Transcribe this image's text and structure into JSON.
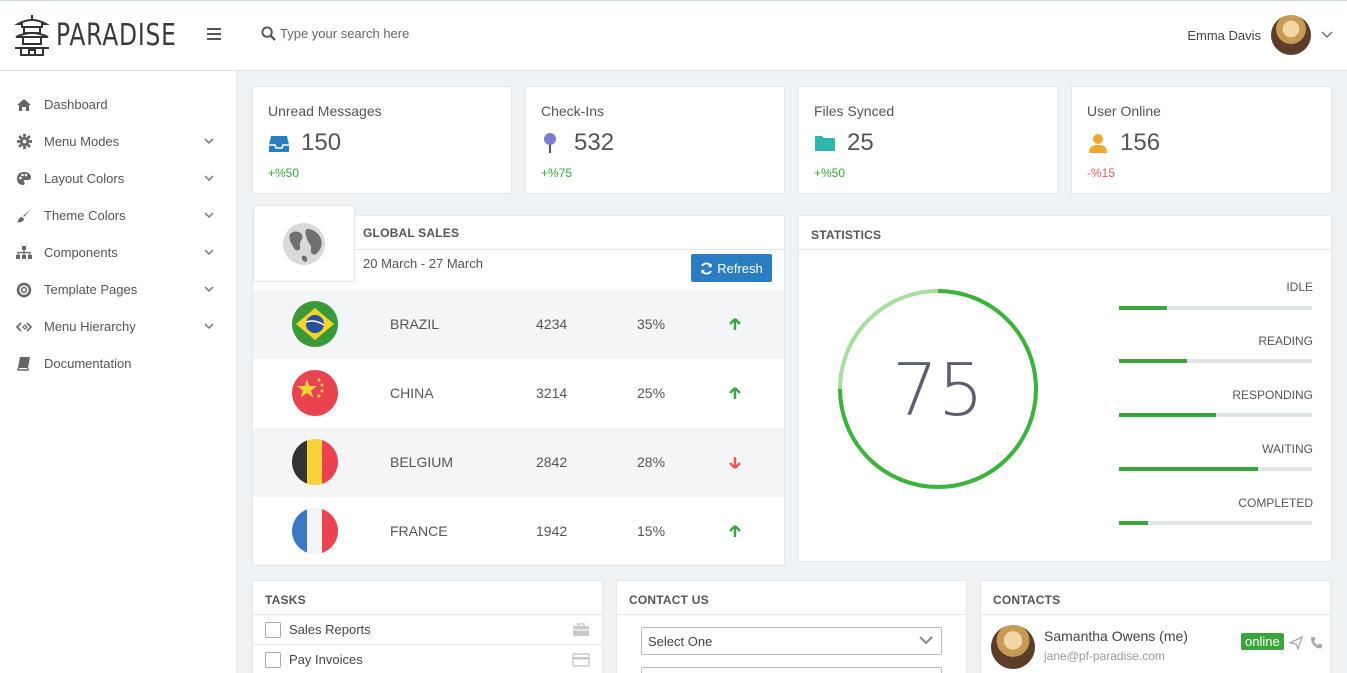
{
  "app": {
    "logo_text": "PARADISE"
  },
  "search": {
    "placeholder": "Type your search here"
  },
  "user": {
    "name": "Emma Davis"
  },
  "sidebar": {
    "items": [
      {
        "label": "Dashboard",
        "icon": "home-icon",
        "has_submenu": false
      },
      {
        "label": "Menu Modes",
        "icon": "gear-icon",
        "has_submenu": true
      },
      {
        "label": "Layout Colors",
        "icon": "palette-icon",
        "has_submenu": true
      },
      {
        "label": "Theme Colors",
        "icon": "brush-icon",
        "has_submenu": true
      },
      {
        "label": "Components",
        "icon": "sitemap-icon",
        "has_submenu": true
      },
      {
        "label": "Template Pages",
        "icon": "life-ring-icon",
        "has_submenu": true
      },
      {
        "label": "Menu Hierarchy",
        "icon": "code-icon",
        "has_submenu": true
      },
      {
        "label": "Documentation",
        "icon": "book-icon",
        "has_submenu": false
      }
    ]
  },
  "stats": [
    {
      "title": "Unread Messages",
      "value": "150",
      "change": "+%50",
      "trend": "positive",
      "icon": "inbox-icon",
      "color": "#2b7dc1"
    },
    {
      "title": "Check-Ins",
      "value": "532",
      "change": "+%75",
      "trend": "positive",
      "icon": "map-pin-icon",
      "color": "#7b7fd4"
    },
    {
      "title": "Files Synced",
      "value": "25",
      "change": "+%50",
      "trend": "positive",
      "icon": "folder-icon",
      "color": "#2fb8ac"
    },
    {
      "title": "User Online",
      "value": "156",
      "change": "-%15",
      "trend": "negative",
      "icon": "user-icon",
      "color": "#f0a830"
    }
  ],
  "global_sales": {
    "title": "GLOBAL SALES",
    "date_range": "20 March - 27 March",
    "refresh_label": "Refresh",
    "rows": [
      {
        "country": "BRAZIL",
        "value": "4234",
        "percent": "35%",
        "trend": "up",
        "flag": "brazil-flag-icon"
      },
      {
        "country": "CHINA",
        "value": "3214",
        "percent": "25%",
        "trend": "up",
        "flag": "china-flag-icon"
      },
      {
        "country": "BELGIUM",
        "value": "2842",
        "percent": "28%",
        "trend": "down",
        "flag": "belgium-flag-icon"
      },
      {
        "country": "FRANCE",
        "value": "1942",
        "percent": "15%",
        "trend": "up",
        "flag": "france-flag-icon"
      }
    ]
  },
  "statistics": {
    "title": "STATISTICS",
    "gauge_value": "75",
    "gauge_fraction": 0.75,
    "bars": [
      {
        "label": "IDLE",
        "fraction": 0.25
      },
      {
        "label": "READING",
        "fraction": 0.35
      },
      {
        "label": "RESPONDING",
        "fraction": 0.5
      },
      {
        "label": "WAITING",
        "fraction": 0.72
      },
      {
        "label": "COMPLETED",
        "fraction": 0.15
      }
    ]
  },
  "tasks": {
    "title": "TASKS",
    "items": [
      {
        "label": "Sales Reports",
        "icon": "briefcase-icon"
      },
      {
        "label": "Pay Invoices",
        "icon": "credit-card-icon"
      }
    ]
  },
  "contact_us": {
    "title": "CONTACT US",
    "select_value": "Select One"
  },
  "contacts": {
    "title": "CONTACTS",
    "items": [
      {
        "name": "Samantha Owens (me)",
        "email": "jane@pf-paradise.com",
        "status": "online"
      }
    ]
  },
  "colors": {
    "accent": "#2b7dc1",
    "positive": "#3aa53a",
    "negative": "#e25c5c"
  }
}
